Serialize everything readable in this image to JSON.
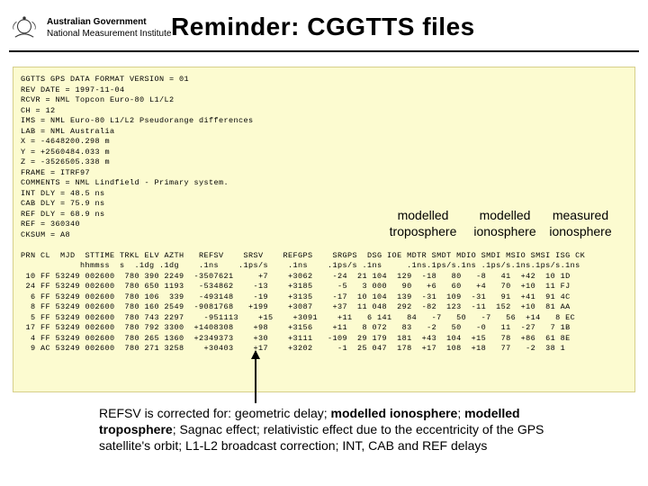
{
  "header": {
    "gov_line1": "Australian Government",
    "gov_line2": "National Measurement Institute",
    "title": "Reminder: CGGTTS files"
  },
  "file_lines": [
    "GGTTS GPS DATA FORMAT VERSION = 01",
    "REV DATE = 1997-11-04",
    "RCVR = NML Topcon Euro-80 L1/L2",
    "CH = 12",
    "IMS = NML Euro-80 L1/L2 Pseudorange differences",
    "LAB = NML Australia",
    "X = -4648200.298 m",
    "Y = +2560484.033 m",
    "Z = -3526505.338 m",
    "FRAME = ITRF97",
    "COMMENTS = NML Lindfield - Primary system.",
    "INT DLY = 48.5 ns",
    "CAB DLY = 75.9 ns",
    "REF DLY = 68.9 ns",
    "REF = 360340",
    "CKSUM = A8",
    "",
    "PRN CL  MJD  STTIME TRKL ELV AZTH   REFSV    SRSV    REFGPS    SRGPS  DSG IOE MDTR SMDT MDIO SMDI MSIO SMSI ISG CK",
    "            hhmmss  s  .1dg .1dg    .1ns    .1ps/s    .1ns    .1ps/s .1ns     .1ns.1ps/s.1ns .1ps/s.1ns.1ps/s.1ns",
    " 10 FF 53249 002600  780 390 2249  -3507621     +7    +3062    -24  21 104  129  -18   80   -8   41  +42  10 1D",
    " 24 FF 53249 002600  780 650 1193   -534862    -13    +3185     -5   3 000   90   +6   60   +4   70  +10  11 FJ",
    "  6 FF 53249 002600  780 106  339   -493148    -19    +3135    -17  10 104  139  -31  109  -31   91  +41  91 4C",
    "  8 FF 53249 002600  780 160 2549  -9081768   +199    +3087    +37  11 048  292  -82  123  -11  152  +10  81 AA",
    "  5 FF 53249 002600  780 743 2297    -951113    +15    +3091    +11   6 141   84   -7   50   -7   56  +14   8 EC",
    " 17 FF 53249 002600  780 792 3300  +1408308    +98    +3156    +11   8 072   83   -2   50   -0   11  -27   7 1B",
    "  4 FF 53249 002600  780 265 1360  +2349373    +30    +3111   -109  29 179  181  +43  104  +15   78  +86  61 8E",
    "  9 AC 53249 002600  780 271 3258    +30403    +17    +3202     -1  25 047  178  +17  108  +18   77   -2  38 1"
  ],
  "annot": {
    "tropo_l1": "modelled",
    "tropo_l2": "troposphere",
    "mion_l1": "modelled",
    "mion_l2": "ionosphere",
    "miono_l1": "measured",
    "miono_l2": "ionosphere"
  },
  "caption": {
    "t1": "REFSV is corrected for: geometric delay; ",
    "b1": "modelled ionosphere",
    "t2": "; ",
    "b2": "modelled troposphere",
    "t3": "; Sagnac effect; relativistic effect due to the eccentricity of the GPS satellite's orbit; L1-L2 broadcast correction; INT, CAB and REF delays"
  }
}
